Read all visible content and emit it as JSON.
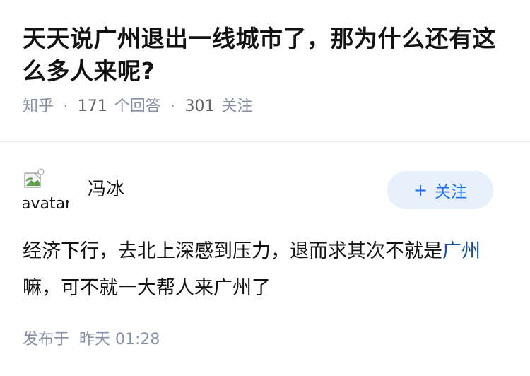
{
  "question": {
    "title": "天天说广州退出一线城市了，那为什么还有这么多人来呢?",
    "source": "知乎",
    "answer_count": "171",
    "answer_label": "个回答",
    "follower_count": "301",
    "follower_label": "关注",
    "separator": "·"
  },
  "answer": {
    "author": {
      "name": "冯冰",
      "avatar_alt": "avatar"
    },
    "follow_button": {
      "icon": "plus-icon",
      "icon_glyph": "+",
      "label": "关注"
    },
    "content": {
      "part1": "经济下行，去北上深感到压力，退而求其次不就是",
      "link_text": "广州",
      "part2": "嘛，可不就一大帮人来广州了"
    },
    "time": {
      "label": "发布于",
      "value": "昨天 01:28"
    }
  },
  "colors": {
    "title": "#121212",
    "meta": "#8590a6",
    "link": "#175199",
    "follow_text": "#1772f6",
    "follow_bg": "#e8f0fb"
  }
}
